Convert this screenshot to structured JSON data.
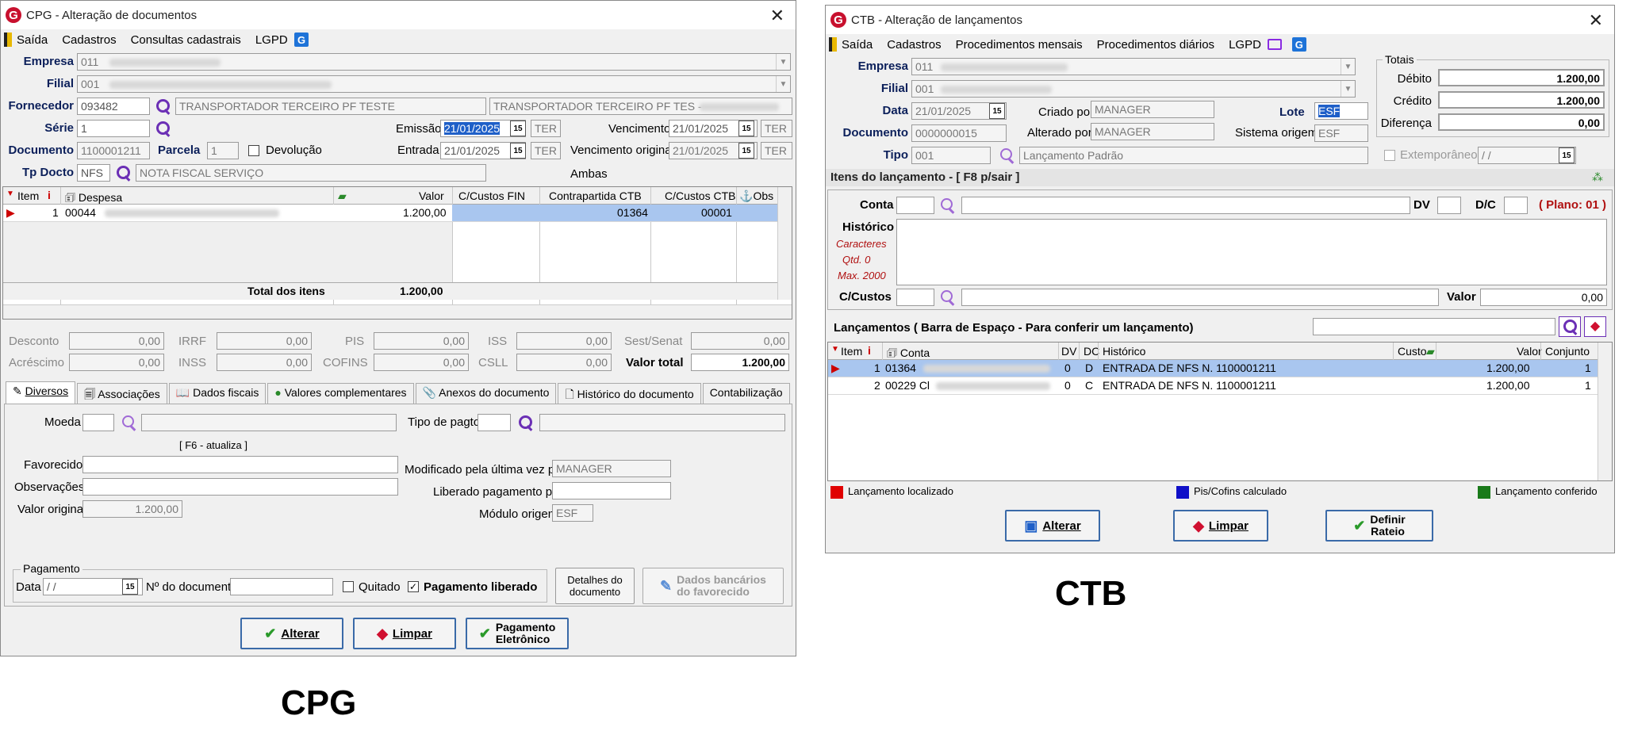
{
  "cpg": {
    "title": "CPG - Alteração de documentos",
    "logo": "G",
    "menu": [
      "Saída",
      "Cadastros",
      "Consultas cadastrais",
      "LGPD"
    ],
    "empresa_label": "Empresa",
    "empresa_value": "011",
    "filial_label": "Filial",
    "filial_value": "001",
    "fornecedor_label": "Fornecedor",
    "fornecedor_value": "093482",
    "fornecedor_name": "TRANSPORTADOR TERCEIRO PF TESTE",
    "fornecedor_name2": "TRANSPORTADOR TERCEIRO PF TES -",
    "serie_label": "Série",
    "serie_value": "1",
    "emissao_label": "Emissão",
    "emissao_value": "21/01/2025",
    "emissao_day": "TER",
    "vencimento_label": "Vencimento",
    "vencimento_value": "21/01/2025",
    "vencimento_day": "TER",
    "documento_label": "Documento",
    "documento_value": "1100001211",
    "parcela_label": "Parcela",
    "parcela_value": "1",
    "devolucao_label": "Devolução",
    "entrada_label": "Entrada",
    "entrada_value": "21/01/2025",
    "entrada_day": "TER",
    "venc_original_label": "Vencimento original",
    "venc_original_value": "21/01/2025",
    "venc_original_day": "TER",
    "tpdocto_label": "Tp Docto",
    "tpdocto_value": "NFS",
    "tpdocto_desc": "NOTA FISCAL SERVIÇO",
    "ambas": "Ambas",
    "grid_headers": [
      "Item",
      "Despesa",
      "Valor",
      "C/Custos FIN",
      "Contrapartida CTB",
      "C/Custos CTB",
      "Obs"
    ],
    "grid_row": {
      "item": "1",
      "despesa": "00044",
      "valor": "1.200,00",
      "ccfin": "",
      "contrapartida": "01364",
      "ccctb": "00001"
    },
    "total_label": "Total dos itens",
    "total_value": "1.200,00",
    "taxes": [
      {
        "label": "Desconto",
        "value": "0,00"
      },
      {
        "label": "IRRF",
        "value": "0,00"
      },
      {
        "label": "PIS",
        "value": "0,00"
      },
      {
        "label": "ISS",
        "value": "0,00"
      },
      {
        "label": "Sest/Senat",
        "value": "0,00"
      },
      {
        "label": "Acréscimo",
        "value": "0,00"
      },
      {
        "label": "INSS",
        "value": "0,00"
      },
      {
        "label": "COFINS",
        "value": "0,00"
      },
      {
        "label": "CSLL",
        "value": "0,00"
      }
    ],
    "valor_total_label": "Valor total",
    "valor_total_value": "1.200,00",
    "tabs": [
      "Diversos",
      "Associações",
      "Dados fiscais",
      "Valores complementares",
      "Anexos do documento",
      "Histórico do documento",
      "Contabilização"
    ],
    "moeda_label": "Moeda",
    "tipo_pagto_label": "Tipo de pagto",
    "f6_label": "[ F6 - atualiza ]",
    "favorecido_label": "Favorecido",
    "observacoes_label": "Observações",
    "valor_original_label": "Valor original",
    "valor_original_value": "1.200,00",
    "modificado_label": "Modificado pela última vez por",
    "modificado_value": "MANAGER",
    "liberado_label": "Liberado pagamento por",
    "modulo_label": "Módulo origem",
    "modulo_value": "ESF",
    "pagamento_group": "Pagamento",
    "data_label": "Data",
    "data_value": " / /",
    "ndoc_label": "Nº do documento",
    "quitado_label": "Quitado",
    "pag_liberado_label": "Pagamento liberado",
    "detalhes_btn": [
      "Detalhes do",
      "documento"
    ],
    "dados_bancarios_btn": [
      "Dados bancários",
      "do favorecido"
    ],
    "btn_alterar": "Alterar",
    "btn_limpar": "Limpar",
    "btn_pagamento": [
      "Pagamento",
      "Eletrônico"
    ],
    "caption": "CPG"
  },
  "ctb": {
    "title": "CTB - Alteração de lançamentos",
    "logo": "G",
    "menu": [
      "Saída",
      "Cadastros",
      "Procedimentos mensais",
      "Procedimentos diários",
      "LGPD"
    ],
    "empresa_label": "Empresa",
    "empresa_value": "011",
    "filial_label": "Filial",
    "filial_value": "001",
    "data_label": "Data",
    "data_value": "21/01/2025",
    "criado_label": "Criado por",
    "criado_value": "MANAGER",
    "lote_label": "Lote",
    "lote_value": "ESF",
    "documento_label": "Documento",
    "documento_value": "0000000015",
    "alterado_label": "Alterado por",
    "alterado_value": "MANAGER",
    "sistema_label": "Sistema origem",
    "sistema_value": "ESF",
    "tipo_label": "Tipo",
    "tipo_value": "001",
    "tipo_desc": "Lançamento Padrão",
    "totais_title": "Totais",
    "debito_label": "Débito",
    "debito_value": "1.200,00",
    "credito_label": "Crédito",
    "credito_value": "1.200,00",
    "diferenca_label": "Diferença",
    "diferenca_value": "0,00",
    "extemporaneo_label": "Extemporâneo",
    "extemporaneo_value": " / /",
    "itens_title": "Itens do lançamento - [ F8 p/sair ]",
    "conta_label": "Conta",
    "dv_label": "DV",
    "dc_label": "D/C",
    "plano_label": "( Plano: 01 )",
    "historico_label": "Histórico",
    "caracteres": "Caracteres",
    "qtd": "Qtd. 0",
    "max": "Max. 2000",
    "ccustos_label": "C/Custos",
    "valor_label": "Valor",
    "valor_value": "0,00",
    "lancamentos_title": "Lançamentos ( Barra de Espaço - Para conferir um lançamento)",
    "grid_headers": [
      "Item",
      "Conta",
      "DV",
      "DC",
      "Histórico",
      "Custo",
      "Valor",
      "Conjunto"
    ],
    "rows": [
      {
        "item": "1",
        "conta": "01364",
        "dv": "0",
        "dc": "D",
        "historico": "ENTRADA DE NFS N. 1100001211",
        "custo": "",
        "valor": "1.200,00",
        "conjunto": "1"
      },
      {
        "item": "2",
        "conta": "00229 Cl",
        "dv": "0",
        "dc": "C",
        "historico": "ENTRADA DE NFS N. 1100001211",
        "custo": "",
        "valor": "1.200,00",
        "conjunto": "1"
      }
    ],
    "legend": [
      {
        "label": "Lançamento localizado",
        "color": "#e00000"
      },
      {
        "label": "Pis/Cofins calculado",
        "color": "#1010c8"
      },
      {
        "label": "Lançamento conferido",
        "color": "#1a7a1a"
      }
    ],
    "btn_alterar": "Alterar",
    "btn_limpar": "Limpar",
    "btn_definir": [
      "Definir",
      "Rateio"
    ],
    "caption": "CTB"
  }
}
